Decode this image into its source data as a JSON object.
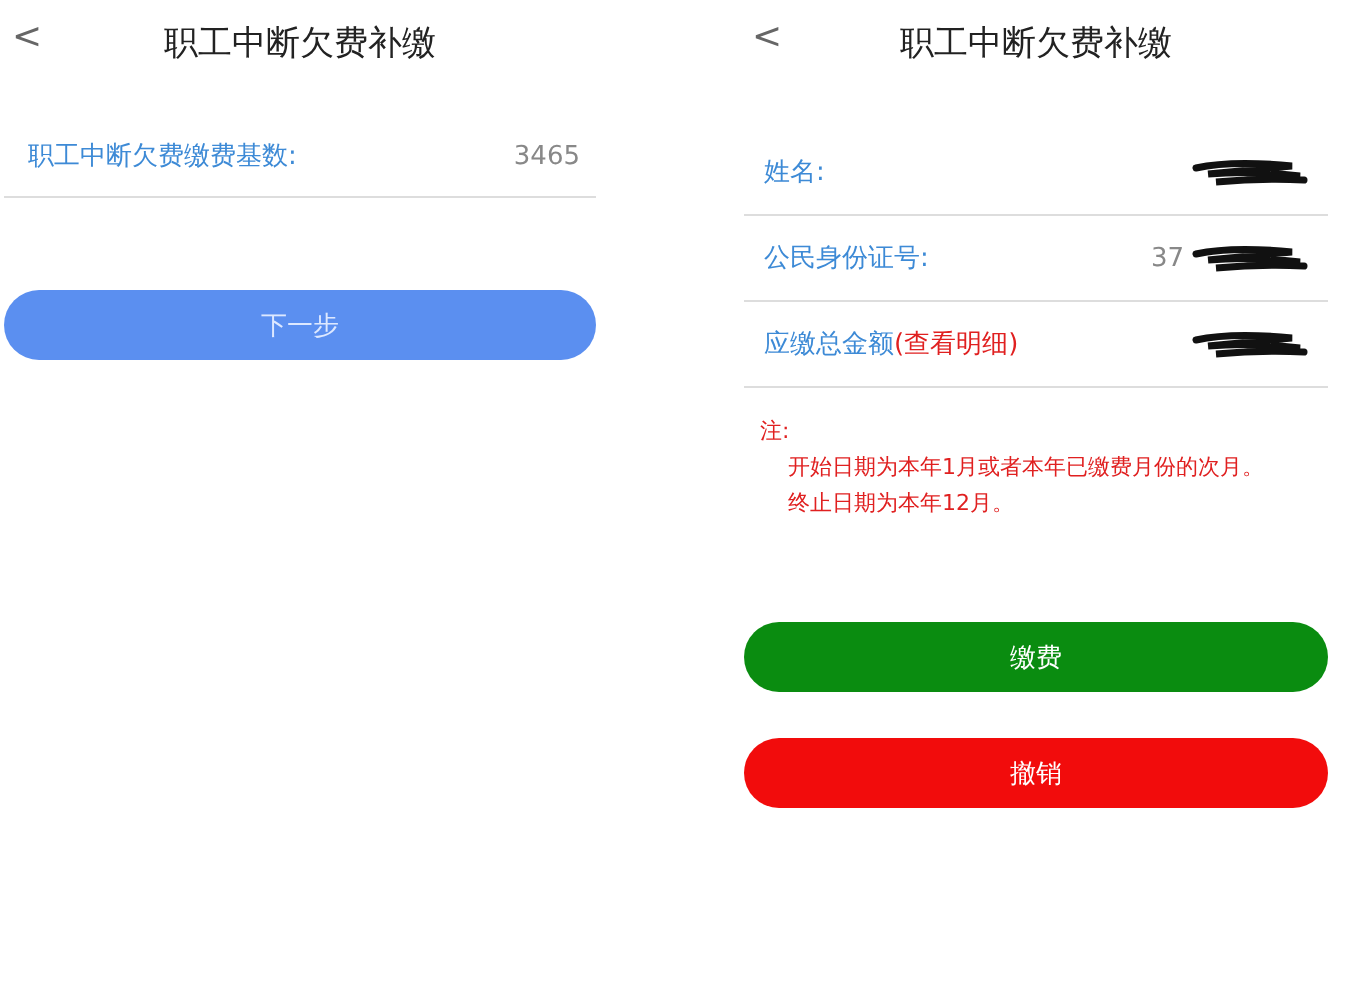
{
  "left_screen": {
    "back": "<",
    "title": "职工中断欠费补缴",
    "fields": [
      {
        "label": "职工中断欠费缴费基数:",
        "value": "3465"
      }
    ],
    "buttons": [
      {
        "label": "下一步",
        "color": "#5b8ff0"
      }
    ]
  },
  "right_screen": {
    "back": "<",
    "title": "职工中断欠费补缴",
    "fields": [
      {
        "label": "姓名:",
        "redacted": true
      },
      {
        "label": "公民身份证号:",
        "value": "37",
        "redacted": true
      },
      {
        "label": "应缴总金额",
        "link": "(查看明细)",
        "redacted": true
      }
    ],
    "note": {
      "heading": "注:",
      "lines": [
        "开始日期为本年1月或者本年已缴费月份的次月。",
        "终止日期为本年12月。"
      ]
    },
    "buttons": [
      {
        "label": "缴费",
        "color": "#0a8c10"
      },
      {
        "label": "撤销",
        "color": "#f20c0c"
      }
    ]
  }
}
